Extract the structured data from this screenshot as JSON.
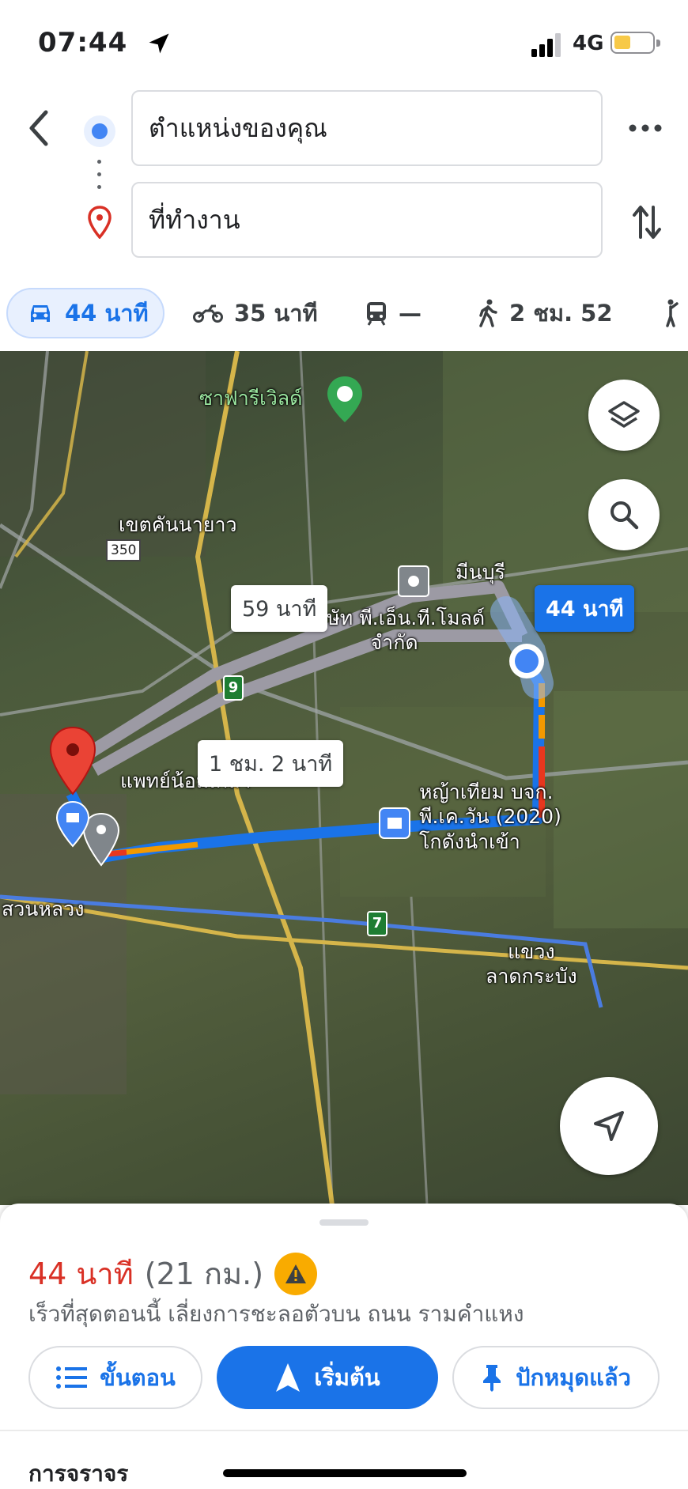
{
  "status_bar": {
    "time": "07:44",
    "network": "4G"
  },
  "search": {
    "origin": "ตำแหน่งของคุณ",
    "destination": "ที่ทำงาน"
  },
  "modes": [
    {
      "icon": "car-icon",
      "label": "44 นาที",
      "selected": true
    },
    {
      "icon": "motorcycle-icon",
      "label": "35 นาที"
    },
    {
      "icon": "transit-icon",
      "label": "—"
    },
    {
      "icon": "walk-icon",
      "label": "2 ชม. 52"
    },
    {
      "icon": "ride-icon",
      "label": ""
    }
  ],
  "map": {
    "place_labels": {
      "safari": "ซาฟารีเวิลด์",
      "khannayao": "เขตคันนายาว",
      "minburi": "มีนบุรี",
      "company": "บริษัท พี.เอ็น.ที.โมลด์\nจำกัด",
      "clinic": "แพทย์น้อมเกลา",
      "grass": "หญ้าเทียม บจก.\nพี.เค.วัน (2020)\nโกดังนำเข้า",
      "suanluang": "สวนหลวง",
      "latkrabang": "แขวง\nลาดกระบัง"
    },
    "route_labels": {
      "main": "44 นาที",
      "alt1": "59 นาที",
      "alt2": "1 ชม. 2 นาที"
    },
    "shields": {
      "route350": "350",
      "hw9": "9",
      "hw7": "7"
    }
  },
  "sheet": {
    "duration": "44 นาที",
    "distance": "(21 กม.)",
    "summary": "เร็วที่สุดตอนนี้ เลี่ยงการชะลอตัวบน ถนน รามคำแหง",
    "steps_label": "ขั้นตอน",
    "start_label": "เริ่มต้น",
    "pinned_label": "ปักหมุดแล้ว",
    "traffic_label": "การจราจร"
  },
  "colors": {
    "accent": "#1a73e8",
    "eta_red": "#d93025",
    "warning": "#f9ab00"
  }
}
